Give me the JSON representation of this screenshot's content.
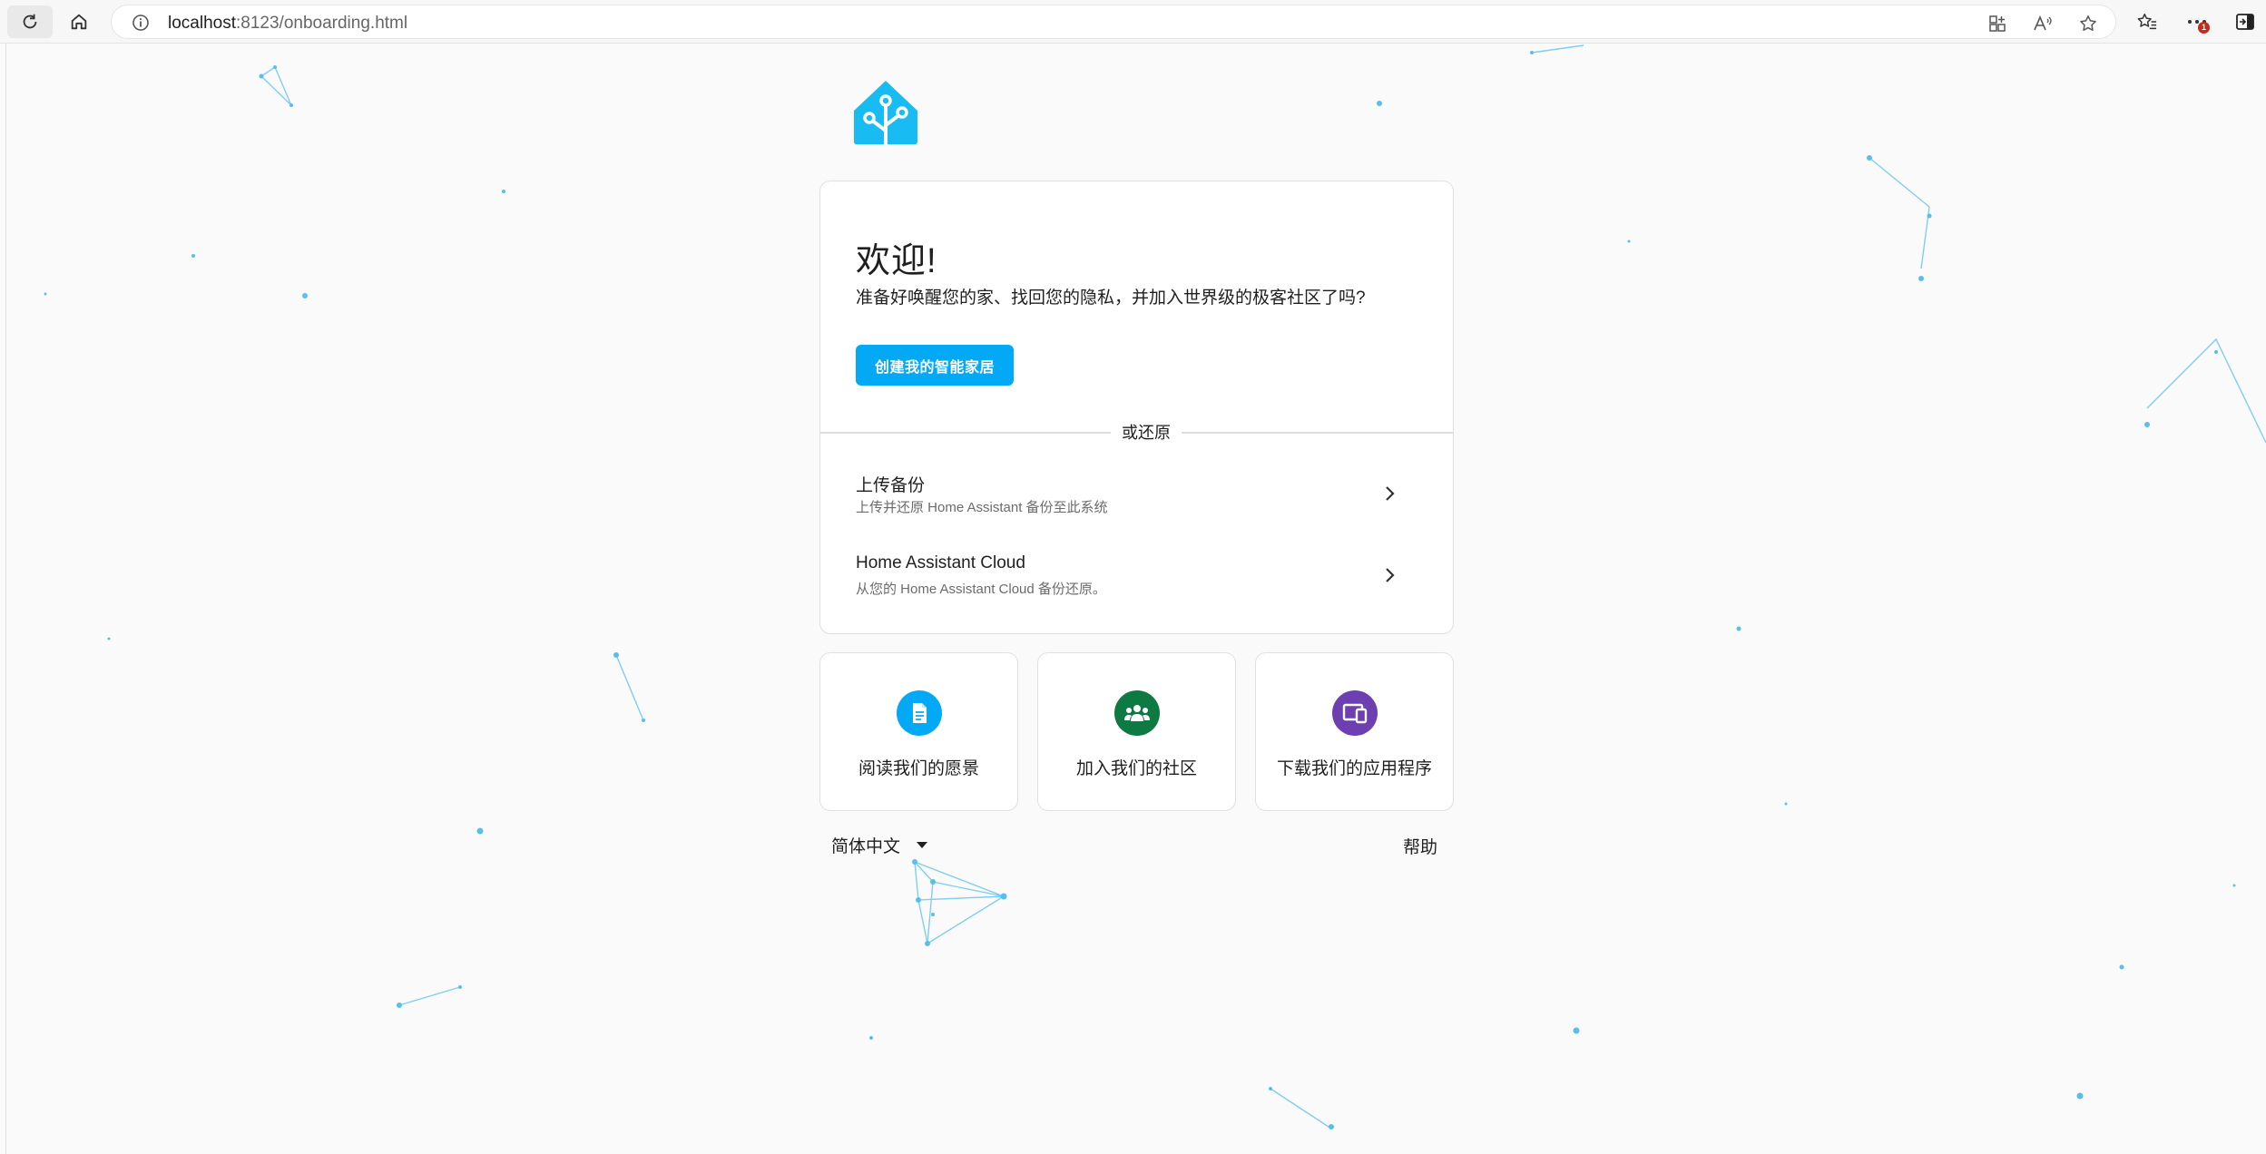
{
  "browser": {
    "address_host": "localhost",
    "address_path": ":8123/onboarding.html",
    "notification_count": "1",
    "icons": [
      "reload-icon",
      "home-icon",
      "info-icon",
      "apps-icon",
      "read-aloud-icon",
      "favorite-star-icon",
      "favorites-icon",
      "more-icon",
      "sidebar-icon"
    ]
  },
  "welcome": {
    "title": "欢迎!",
    "description": "准备好唤醒您的家、找回您的隐私，并加入世界级的极客社区了吗?",
    "create_button": "创建我的智能家居"
  },
  "restore": {
    "divider_label": "或还原",
    "items": [
      {
        "title": "上传备份",
        "subtitle": "上传并还原 Home Assistant 备份至此系统"
      },
      {
        "title": "Home Assistant Cloud",
        "subtitle": "从您的 Home Assistant Cloud 备份还原。"
      }
    ]
  },
  "links": [
    {
      "label": "阅读我们的愿景",
      "icon": "document-icon",
      "color": "#03a9f4"
    },
    {
      "label": "加入我们的社区",
      "icon": "community-icon",
      "color": "#0e7a43"
    },
    {
      "label": "下载我们的应用程序",
      "icon": "devices-icon",
      "color": "#6d3fb0"
    }
  ],
  "footer": {
    "language": "简体中文",
    "help": "帮助"
  },
  "colors": {
    "accent": "#03a9f4",
    "particles": "#57bfeb"
  }
}
